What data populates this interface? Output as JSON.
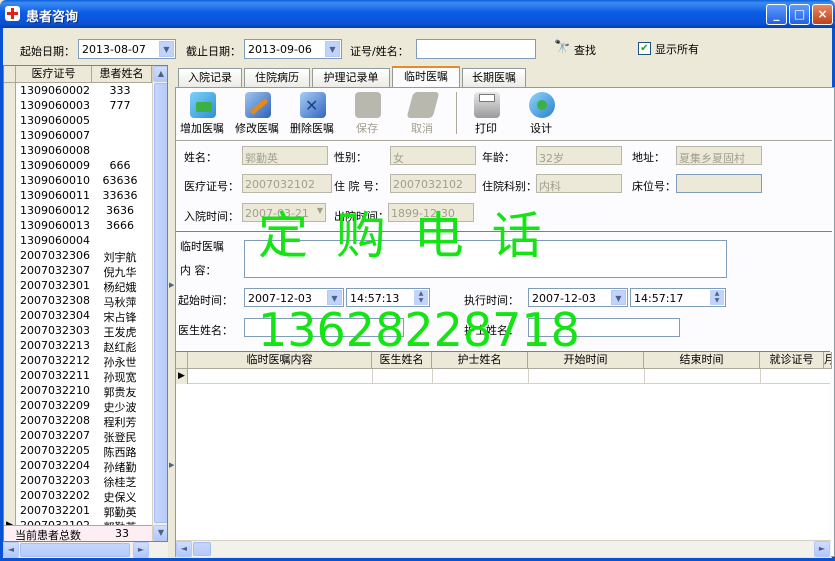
{
  "window": {
    "title": "患者咨询",
    "buttons": [
      "_",
      "□",
      "×"
    ]
  },
  "filter": {
    "start_label": "起始日期：",
    "start_value": "2013-08-07",
    "end_label": "截止日期：",
    "end_value": "2013-09-06",
    "id_label": "证号/姓名：",
    "id_value": "",
    "search_label": "查找",
    "show_all_label": "显示所有",
    "show_all_checked": true
  },
  "patients": {
    "col_id": "医疗证号",
    "col_name": "患者姓名",
    "rows": [
      {
        "id": "1309060002",
        "name": "333"
      },
      {
        "id": "1309060003",
        "name": "777"
      },
      {
        "id": "1309060005",
        "name": ""
      },
      {
        "id": "1309060007",
        "name": ""
      },
      {
        "id": "1309060008",
        "name": ""
      },
      {
        "id": "1309060009",
        "name": "666"
      },
      {
        "id": "1309060010",
        "name": "63636"
      },
      {
        "id": "1309060011",
        "name": "33636"
      },
      {
        "id": "1309060012",
        "name": "3636"
      },
      {
        "id": "1309060013",
        "name": "3666"
      },
      {
        "id": "1309060004",
        "name": ""
      },
      {
        "id": "2007032306",
        "name": "刘宇航"
      },
      {
        "id": "2007032307",
        "name": "倪九华"
      },
      {
        "id": "2007032301",
        "name": "杨纪娥"
      },
      {
        "id": "2007032308",
        "name": "马秋萍"
      },
      {
        "id": "2007032304",
        "name": "宋占锋"
      },
      {
        "id": "2007032303",
        "name": "王发虎"
      },
      {
        "id": "2007032213",
        "name": "赵红彪"
      },
      {
        "id": "2007032212",
        "name": "孙永世"
      },
      {
        "id": "2007032211",
        "name": "孙现宽"
      },
      {
        "id": "2007032210",
        "name": "郭贵友"
      },
      {
        "id": "2007032209",
        "name": "史少波"
      },
      {
        "id": "2007032208",
        "name": "程利芳"
      },
      {
        "id": "2007032207",
        "name": "张登民"
      },
      {
        "id": "2007032205",
        "name": "陈西路"
      },
      {
        "id": "2007032204",
        "name": "孙绪勤"
      },
      {
        "id": "2007032203",
        "name": "徐桂芝"
      },
      {
        "id": "2007032202",
        "name": "史保义"
      },
      {
        "id": "2007032201",
        "name": "郭勤英"
      },
      {
        "id": "2007032102",
        "name": "郭勤英"
      }
    ],
    "total_label": "当前患者总数",
    "total_value": "33"
  },
  "tabs": [
    "入院记录",
    "住院病历",
    "护理记录单",
    "临时医嘱",
    "长期医嘱"
  ],
  "toolbar": {
    "add": "增加医嘱",
    "edit": "修改医嘱",
    "delete": "删除医嘱",
    "save": "保存",
    "cancel": "取消",
    "print": "打印",
    "design": "设计"
  },
  "info": {
    "name_label": "姓名：",
    "name": "郭勤英",
    "sex_label": "性别：",
    "sex": "女",
    "age_label": "年龄：",
    "age": "32岁",
    "addr_label": "地址：",
    "addr": "夏集乡夏固村",
    "card_label": "医疗证号：",
    "card": "2007032102",
    "hosp_label": "住 院 号：",
    "hosp": "2007032102",
    "dept_label": "住院科别：",
    "dept": "内科",
    "bed_label": "床位号：",
    "bed": "",
    "admit_label": "入院时间：",
    "admit": "2007-03-21",
    "discharge_label": "出院时间：",
    "discharge": "1899-12-30"
  },
  "order": {
    "heading": "临时医嘱",
    "content_label": "内    容：",
    "content": "",
    "start_label": "起始时间：",
    "start_date": "2007-12-03",
    "start_time": "14:57:13",
    "exec_label": "执行时间：",
    "exec_date": "2007-12-03",
    "exec_time": "14:57:17",
    "doctor_label": "医生姓名：",
    "doctor": "",
    "nurse_label": "护士姓名：",
    "nurse": ""
  },
  "grid": {
    "columns": [
      "临时医嘱内容",
      "医生姓名",
      "护士姓名",
      "开始时间",
      "结束时间",
      "就诊证号",
      "月"
    ]
  },
  "watermark": {
    "line1": "定  购  电  话",
    "line2": "13628228718"
  },
  "colors": {
    "title_bar": "#0A52D4",
    "watermark": "#14E314",
    "tab_highlight": "#E68B2C"
  }
}
